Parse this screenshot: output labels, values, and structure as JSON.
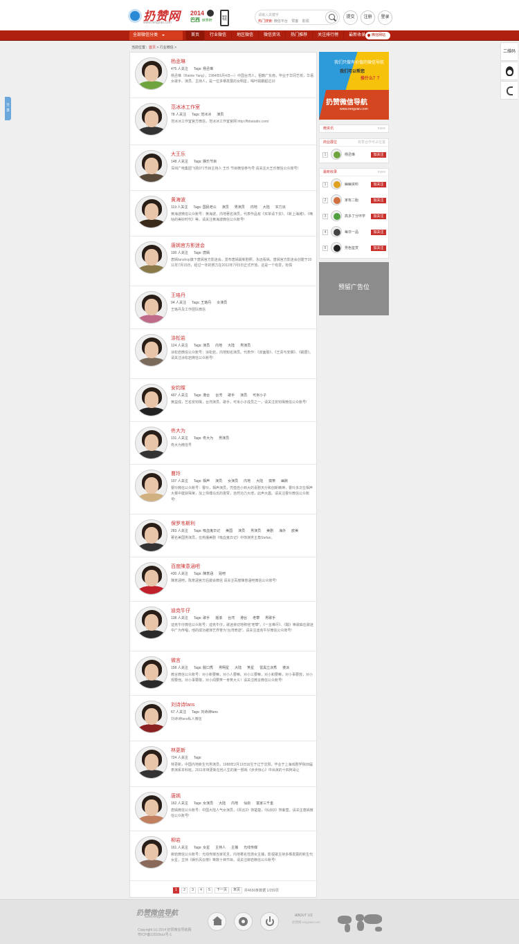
{
  "header": {
    "logo_text": "扔赞网",
    "logo_sub": "www.rengzan.com",
    "badge_year": "2014",
    "badge_country": "巴西",
    "badge_sub": "世界杯",
    "phone_label": "微信导航",
    "search_placeholder": "请输入关键字",
    "hot_label": "热门搜索:",
    "hot_items": [
      "微信平台",
      "赞客",
      "影视"
    ],
    "btn_submit": "提交",
    "btn_register": "注册",
    "btn_login": "登录"
  },
  "nav": {
    "all_label": "全部微信分类",
    "items": [
      "首页",
      "行业微信",
      "地区微信",
      "微信资讯",
      "热门推荐",
      "关注排行榜",
      "最新收录"
    ],
    "wx_site": "微信网站"
  },
  "crumb": {
    "prefix": "当前位置：",
    "home": "首页",
    "sep": " > ",
    "cat": "行业微信",
    "tail": " >"
  },
  "entries": [
    {
      "name": "杨丞琳",
      "followers": "475 人关注",
      "tags": [
        "Tags: 杨丞琳"
      ],
      "desc": "杨丞琳（Rainie Yang），1984年6月4日—）中国台湾人，祖籍广东南，毕业于华冈艺校，华语女歌手、演员、主持人，是一位多栖发展的女明星，喝叶娟娜超过10",
      "color": "#6fa33e"
    },
    {
      "name": "范冰冰工作室",
      "followers": "78 人关注",
      "tags": [
        "Tags: 范冰冰",
        "演员"
      ],
      "desc": "范冰冰工作室官方微信，范冰冰工作室官网 http://fbbstudio.com/",
      "color": "#333333"
    },
    {
      "name": "大王乐",
      "followers": "148 人关注",
      "tags": [
        "Tags: 娱乐节目"
      ],
      "desc": "深圳广电集团飞扬971节目主持人 王乐 节目微信参与号 请关注大王乐微信公众账号!",
      "color": "#5a4a3a"
    },
    {
      "name": "黄海波",
      "followers": "119 人关注",
      "tags": [
        "Tags: 国民老公",
        "演员",
        "男演员",
        "内地",
        "大陆",
        "实力派"
      ],
      "desc": "黄海波微信公众账号：黄海波，内地著名演员，代表作品有《买单请下去》、《新上海滩》、《嘀咕的美好时代》等。请关注黄海波微信公众账号!",
      "color": "#3a2a1a"
    },
    {
      "name": "唐嫣官方影迷会",
      "followers": "100 人关注",
      "tags": [
        "Tags: 唐嫣"
      ],
      "desc": "唐嫣fanshop旗下唐嫣官方影迷会。发布唐嫣最新剧照，永远看嫣。唐嫣官方影迷会创建于2011年7月15日，经过一年的努力在2012年7月5日正式开放。这是一个有爱，有情",
      "color": "#8a7a4a"
    },
    {
      "name": "王珞丹",
      "followers": "94 人关注",
      "tags": [
        "Tags: 王珞丹",
        "女演员"
      ],
      "desc": "王珞丹及工作团队微信",
      "color": "#c06a8a"
    },
    {
      "name": "涂松岩",
      "followers": "124 人关注",
      "tags": [
        "Tags: 演员",
        "内地",
        "大陆",
        "男演员"
      ],
      "desc": "涂松岩微信公众账号：涂松岩，内地知名演员。代表作：《双面胶》、《王贵与安娜》、《蜗居》。请关注涂松岩微信公众账号!",
      "color": "#7a6a5a"
    },
    {
      "name": "安钧璨",
      "followers": "497 人关注",
      "tags": [
        "Tags: 港台",
        "台湾",
        "歌手",
        "演员",
        "可米小子"
      ],
      "desc": "黄益成，艺名安钧璨，台湾演员、歌手，可米小子成员之一。请关注安钧璨微信公众账号!",
      "color": "#222222"
    },
    {
      "name": "佟大为",
      "followers": "131 人关注",
      "tags": [
        "Tags: 佟大为",
        "男演员"
      ],
      "desc": "佟大为微信号",
      "color": "#333333"
    },
    {
      "name": "曹玲",
      "followers": "107 人关注",
      "tags": [
        "Tags: 相声",
        "演员",
        "女演员",
        "内地",
        "大陆",
        "搞笑",
        "幽默"
      ],
      "desc": "曹玲微信公众账号：曹玲，相声演员，凭借自小到大的喜剧天分和创新精神，曹玲多次在相声大赛中屡获殊荣，加上师傅马氏的褒赞，自然功力大增，此声大震。请关注曹玲微信公众账号!",
      "color": "#d0b080"
    },
    {
      "name": "保罗韦斯利",
      "followers": "283 人关注",
      "tags": [
        "Tags: 吸血鬼日记",
        "美国",
        "演员",
        "男演员",
        "美剧",
        "海外",
        "欧美"
      ],
      "desc": "著名美国男演员，在热播美剧《吸血鬼日记》中饰演男主角Stefan。",
      "color": "#333333"
    },
    {
      "name": "百度陳意涵吧",
      "followers": "430 人关注",
      "tags": [
        "Tags: 陳意涵",
        "贴吧"
      ],
      "desc": "陳意涵吧，陈意涵官方后援会微信 请关注百度陳意涵吧微信公众账号!",
      "color": "#c0202a"
    },
    {
      "name": "迪克牛仔",
      "followers": "138 人关注",
      "tags": [
        "Tags: 歌手",
        "摇滚",
        "台湾",
        "港台",
        "老攀",
        "男歌手"
      ],
      "desc": "迪克牛仔微信公众账号：迪克牛仔，歌迷亲切地称他“老攀”。《一言难尽》、《酸》等歌曲在歌迷中广为传唱，他的成功被演艺界誉为“台湾奇迹”。请关注迪克牛仔微信公众账号!",
      "color": "#2a2a2a"
    },
    {
      "name": "微言",
      "followers": "158 人关注",
      "tags": [
        "Tags: 脱口秀",
        "男明星",
        "大陆",
        "笑星",
        "雷黑立派秀",
        "婆派"
      ],
      "desc": "微言微信公众账号：对小新要嘛，对小人要嘛。对小三要嘛，对小和要嘛，对小事要放，对小规要他。对小事要敢，对小闻要笑一肯笑大义！请关注微言微信公众账号!",
      "color": "#2a2a2a"
    },
    {
      "name": "刘诗诗fans",
      "followers": "67 人关注",
      "tags": [
        "Tags: 刘诗诗fans"
      ],
      "desc": "刘诗诗fans私人微信",
      "color": "#8a2020"
    },
    {
      "name": "林更新",
      "followers": "724 人关注",
      "tags": [
        "Tags:"
      ],
      "desc": "林更新，中国内地新生代男演员，1988年2月13日出生于辽宁沈阳，毕业于上海戏剧学院08届表演系本科班。2011年林更新在他人生的第一部戏《步步惊心》中出演的十四阿哥让",
      "color": "#333333"
    },
    {
      "name": "唐嫣",
      "followers": "162 人关注",
      "tags": [
        "Tags: 女演员",
        "大陆",
        "内地",
        "仙剑",
        "富家三千金"
      ],
      "desc": "唐嫣微信公众账号：中国大陆人气女演员，《风云2》饰楚楚，《仙剑3》饰紫萱，请关注唐嫣微信公众账号!",
      "color": "#c08060"
    },
    {
      "name": "柳岩",
      "followers": "161 人关注",
      "tags": [
        "Tags: 女星",
        "主持人",
        "主播",
        "光线传媒"
      ],
      "desc": "柳岩微信公众账号：光线传媒当家花旦，内地著名性感女主播，影视歌主持多栖发展的新生代女星，主持《娱乐风云榜》等数十档节目。请关注柳岩微信公众账号!",
      "color": "#8a6a5a"
    }
  ],
  "pager": {
    "pages": [
      "1",
      "2",
      "3",
      "4",
      "5",
      "下一页",
      "末页"
    ],
    "info": "共4656条数据 1/259页"
  },
  "sidebar": {
    "banner": {
      "t1": "我们只做有价值的微信导航",
      "t2": "我们可以帮您",
      "t3": "推什么？？",
      "t4": "扔赞微信导航",
      "t5": "www.rengzan.com"
    },
    "news": {
      "title": "微资讯",
      "more": "more"
    },
    "biz": {
      "title": "商业展位",
      "note": "有意合作可占位置",
      "items": [
        {
          "num": "1",
          "name": "杨丞琳",
          "btn": "加关注",
          "color": "#6fa33e"
        }
      ]
    },
    "latest": {
      "title": "最新收录",
      "more": "more",
      "items": [
        {
          "num": "1",
          "name": "幽幽资料",
          "btn": "加关注",
          "color": "#e0a020"
        },
        {
          "num": "2",
          "name": "家有二胎",
          "btn": "加关注",
          "color": "#d07040"
        },
        {
          "num": "3",
          "name": "高多了分环学",
          "btn": "加关注",
          "color": "#50a040"
        },
        {
          "num": "4",
          "name": "每日一品",
          "btn": "加关注",
          "color": "#444444"
        },
        {
          "num": "5",
          "name": "男色鉴赏",
          "btn": "加关注",
          "color": "#222222"
        }
      ]
    },
    "ad": "预留广告位"
  },
  "share_label": "分享",
  "float": {
    "qr": "二维码"
  },
  "footer": {
    "logo": "扔赞微信导航",
    "url": "www.rengzan.com",
    "copyright": "Copyright (c) 2014 扔赞微信导航网",
    "icp": "粤ICP备12010xxx号-1",
    "about": "ABOUT US",
    "about_sub": "扔赞网 rengzan.com"
  }
}
